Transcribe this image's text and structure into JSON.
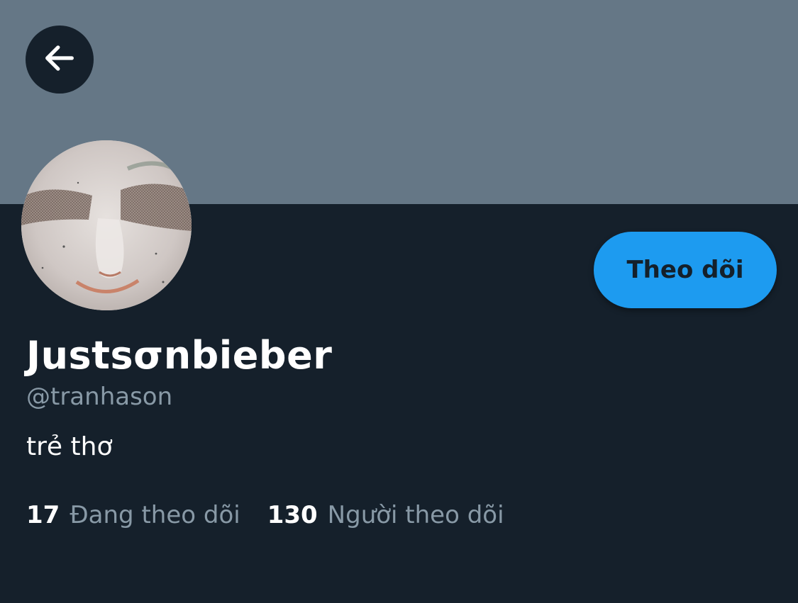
{
  "profile": {
    "display_name": "Justsσnbieber",
    "handle": "@tranhason",
    "bio": "trẻ thơ",
    "follow_label": "Theo dõi",
    "stats": [
      {
        "count": "17",
        "label": "Đang theo dõi"
      },
      {
        "count": "130",
        "label": "Người theo dõi"
      }
    ]
  },
  "icons": {
    "back": "arrow-left-icon",
    "avatar": "avatar"
  },
  "colors": {
    "background": "#15202b",
    "banner": "#657786",
    "accent": "#1d9bf0",
    "secondary_text": "#8899a6"
  }
}
